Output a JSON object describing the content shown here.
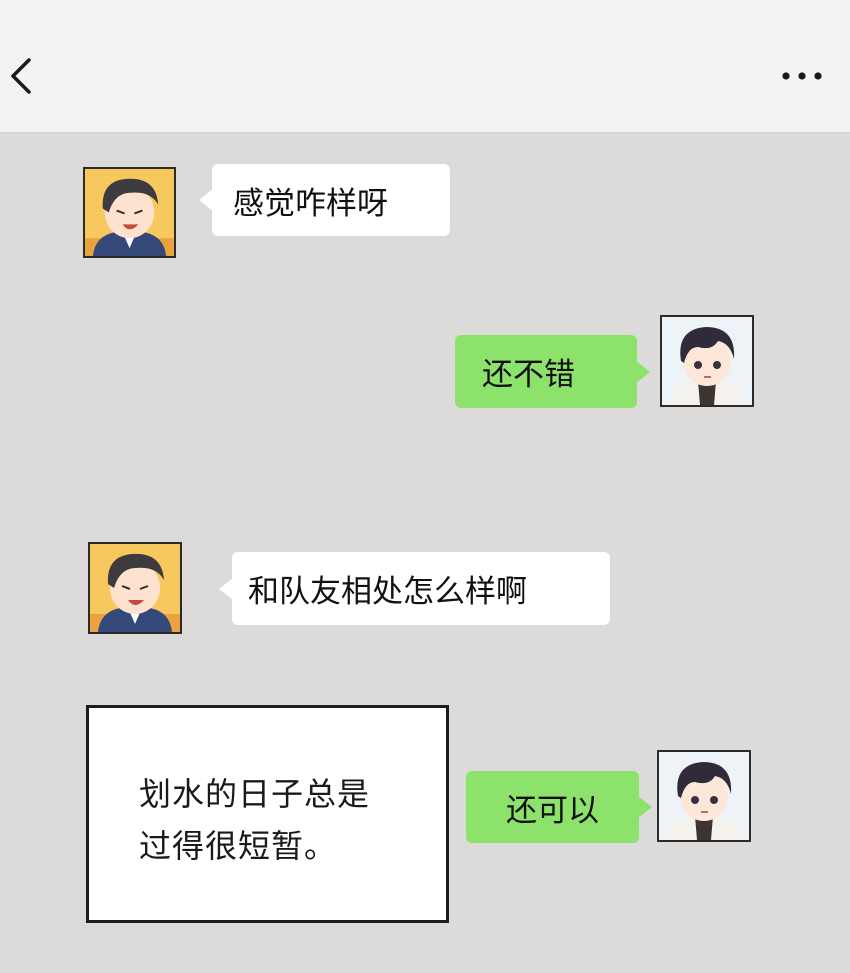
{
  "header": {
    "back_icon": "chevron-left-icon",
    "more_icon": "more-horizontal-icon"
  },
  "messages": [
    {
      "side": "left",
      "sender": "boss-avatar",
      "text": "感觉咋样呀"
    },
    {
      "side": "right",
      "sender": "player-avatar",
      "text": "还不错"
    },
    {
      "side": "left",
      "sender": "boss-avatar",
      "text": "和队友相处怎么样啊"
    },
    {
      "side": "right",
      "sender": "player-avatar",
      "text": "还可以"
    }
  ],
  "narration": {
    "line1": "划水的日子总是",
    "line2": "过得很短暂。"
  },
  "colors": {
    "chat_background": "#dcdbda",
    "top_bar": "#f3f3f3",
    "incoming_bubble": "#ffffff",
    "outgoing_bubble": "#8de26c"
  }
}
